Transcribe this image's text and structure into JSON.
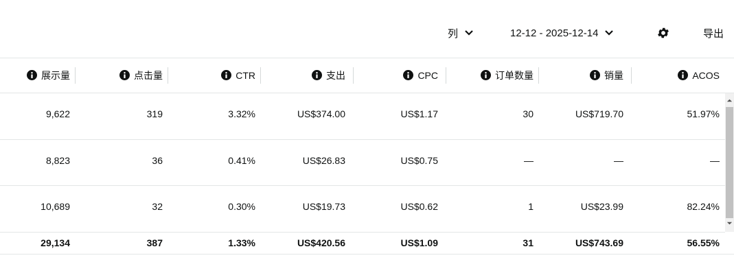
{
  "toolbar": {
    "columns_label": "列",
    "date_range": "12-12 - 2025-12-14",
    "export_label": "导出",
    "settings_icon": "gear-icon"
  },
  "columns": [
    {
      "key": "impressions",
      "label": "展示量"
    },
    {
      "key": "clicks",
      "label": "点击量"
    },
    {
      "key": "ctr",
      "label": "CTR"
    },
    {
      "key": "spend",
      "label": "支出"
    },
    {
      "key": "cpc",
      "label": "CPC"
    },
    {
      "key": "orders",
      "label": "订单数量"
    },
    {
      "key": "sales",
      "label": "销量"
    },
    {
      "key": "acos",
      "label": "ACOS"
    }
  ],
  "rows": [
    {
      "impressions": "9,622",
      "clicks": "319",
      "ctr": "3.32%",
      "spend": "US$374.00",
      "cpc": "US$1.17",
      "orders": "30",
      "sales": "US$719.70",
      "acos": "51.97%"
    },
    {
      "impressions": "8,823",
      "clicks": "36",
      "ctr": "0.41%",
      "spend": "US$26.83",
      "cpc": "US$0.75",
      "orders": "—",
      "sales": "—",
      "acos": "—"
    },
    {
      "impressions": "10,689",
      "clicks": "32",
      "ctr": "0.30%",
      "spend": "US$19.73",
      "cpc": "US$0.62",
      "orders": "1",
      "sales": "US$23.99",
      "acos": "82.24%"
    }
  ],
  "totals": {
    "impressions": "29,134",
    "clicks": "387",
    "ctr": "1.33%",
    "spend": "US$420.56",
    "cpc": "US$1.09",
    "orders": "31",
    "sales": "US$743.69",
    "acos": "56.55%"
  },
  "colors": {
    "border": "#e3e6e6",
    "text": "#0f1111",
    "scrollbar": "#c1c1c1"
  }
}
